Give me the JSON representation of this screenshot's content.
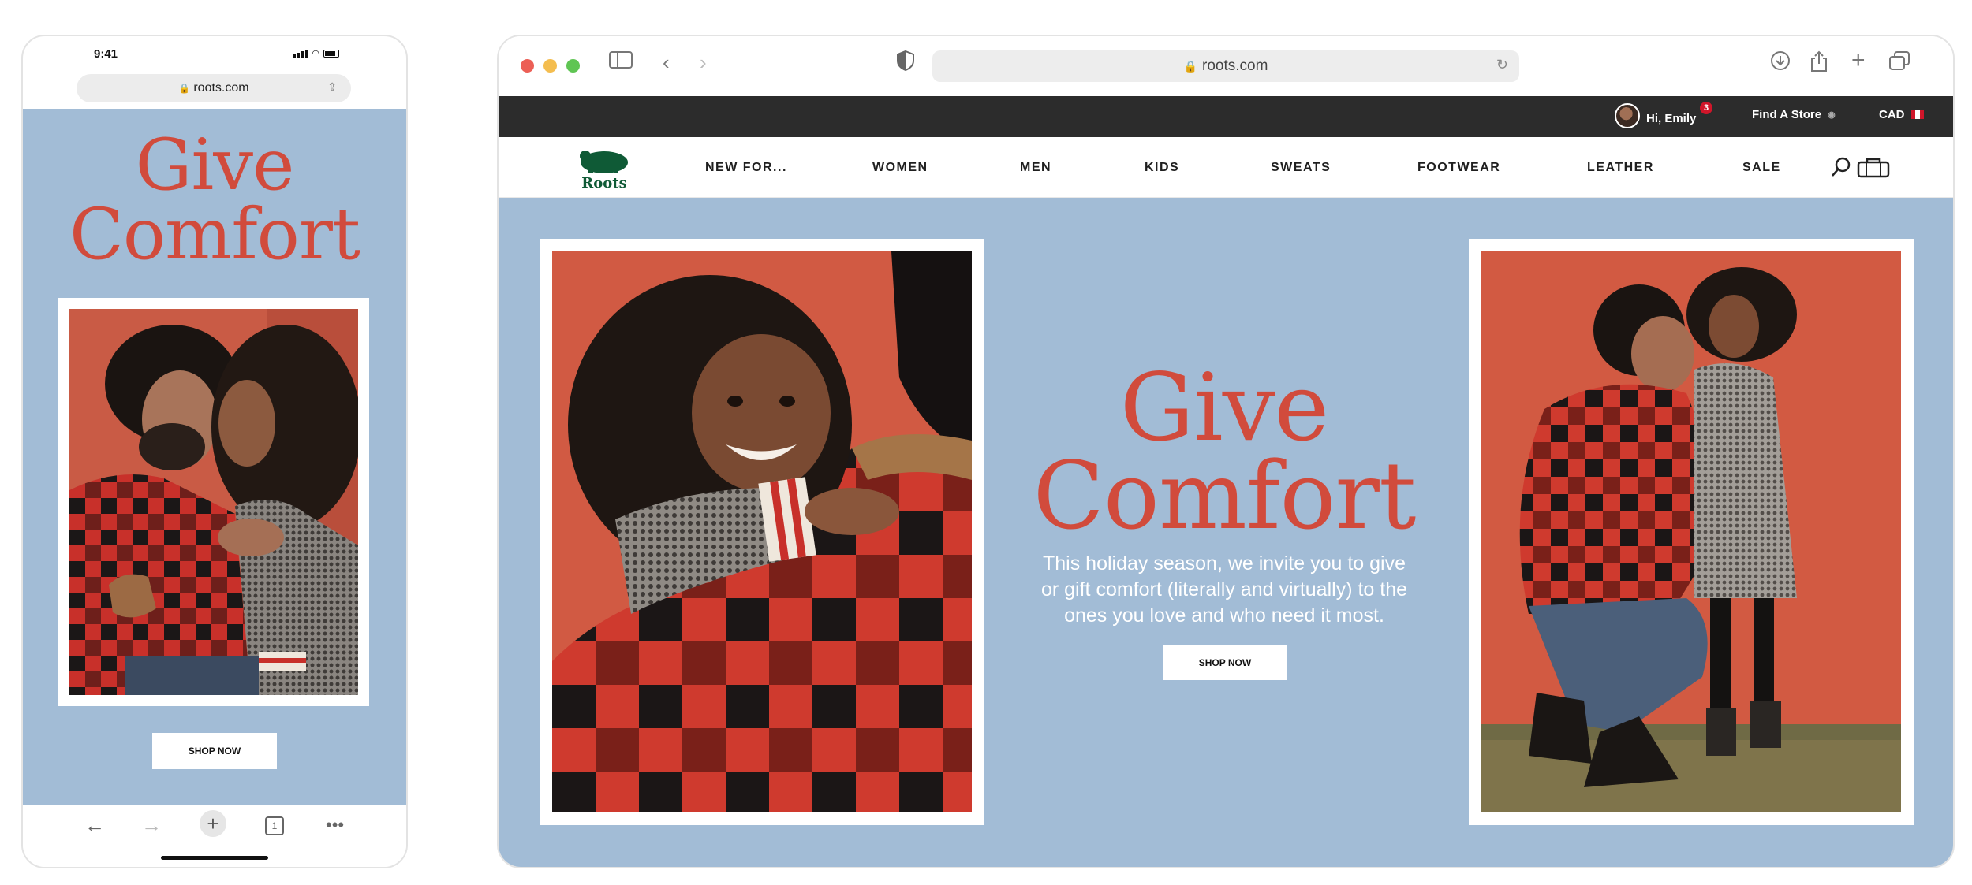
{
  "colors": {
    "hero_bg": "#a2bcd6",
    "headline_red": "#d14b3c",
    "utility_bar": "#2c2c2c",
    "notification": "#d0162a"
  },
  "phone": {
    "status": {
      "time": "9:41"
    },
    "url": "roots.com",
    "headline_line1": "Give",
    "headline_line2": "Comfort",
    "shop_now": "SHOP NOW",
    "toolbar": {
      "tabs_count": "1",
      "icons": [
        "back-arrow-icon",
        "forward-arrow-icon",
        "plus-icon",
        "tabs-icon",
        "more-icon"
      ]
    }
  },
  "browser": {
    "url": "roots.com",
    "chrome_icons": [
      "sidebar-icon",
      "back-icon",
      "forward-icon",
      "shield-icon",
      "reload-icon",
      "download-icon",
      "share-icon",
      "new-tab-icon",
      "tab-overview-icon"
    ],
    "utility": {
      "greeting": "Hi, Emily",
      "notification_count": "3",
      "find_store": "Find A Store",
      "currency": "CAD"
    },
    "logo_text": "Roots",
    "nav": [
      "NEW FOR...",
      "WOMEN",
      "MEN",
      "KIDS",
      "SWEATS",
      "FOOTWEAR",
      "LEATHER",
      "SALE"
    ],
    "hero": {
      "headline_line1": "Give",
      "headline_line2": "Comfort",
      "body": "This holiday season, we invite you to give or gift comfort (literally and virtually) to the ones you love and who need it most.",
      "shop_now": "SHOP NOW"
    }
  }
}
